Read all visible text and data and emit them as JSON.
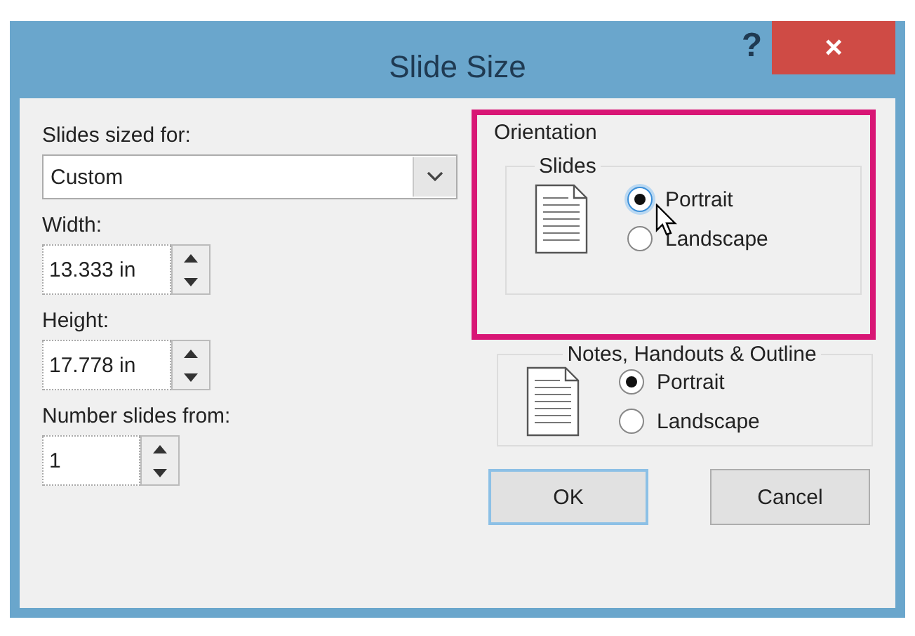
{
  "window": {
    "title": "Slide Size",
    "help": "?",
    "close": "×"
  },
  "slides_sized_for": {
    "label": "Slides sized for:",
    "value": "Custom"
  },
  "width": {
    "label": "Width:",
    "value": "13.333 in"
  },
  "height": {
    "label": "Height:",
    "value": "17.778 in"
  },
  "number_from": {
    "label": "Number slides from:",
    "value": "1"
  },
  "orientation": {
    "title": "Orientation",
    "highlighted": true,
    "groups": [
      {
        "title": "Slides",
        "options": [
          {
            "label": "Portrait",
            "selected": true,
            "focused": true
          },
          {
            "label": "Landscape",
            "selected": false,
            "focused": false
          }
        ]
      },
      {
        "title": "Notes, Handouts & Outline",
        "options": [
          {
            "label": "Portrait",
            "selected": true,
            "focused": false
          },
          {
            "label": "Landscape",
            "selected": false,
            "focused": false
          }
        ]
      }
    ]
  },
  "buttons": [
    {
      "label": "OK",
      "default": true
    },
    {
      "label": "Cancel",
      "default": false
    }
  ]
}
